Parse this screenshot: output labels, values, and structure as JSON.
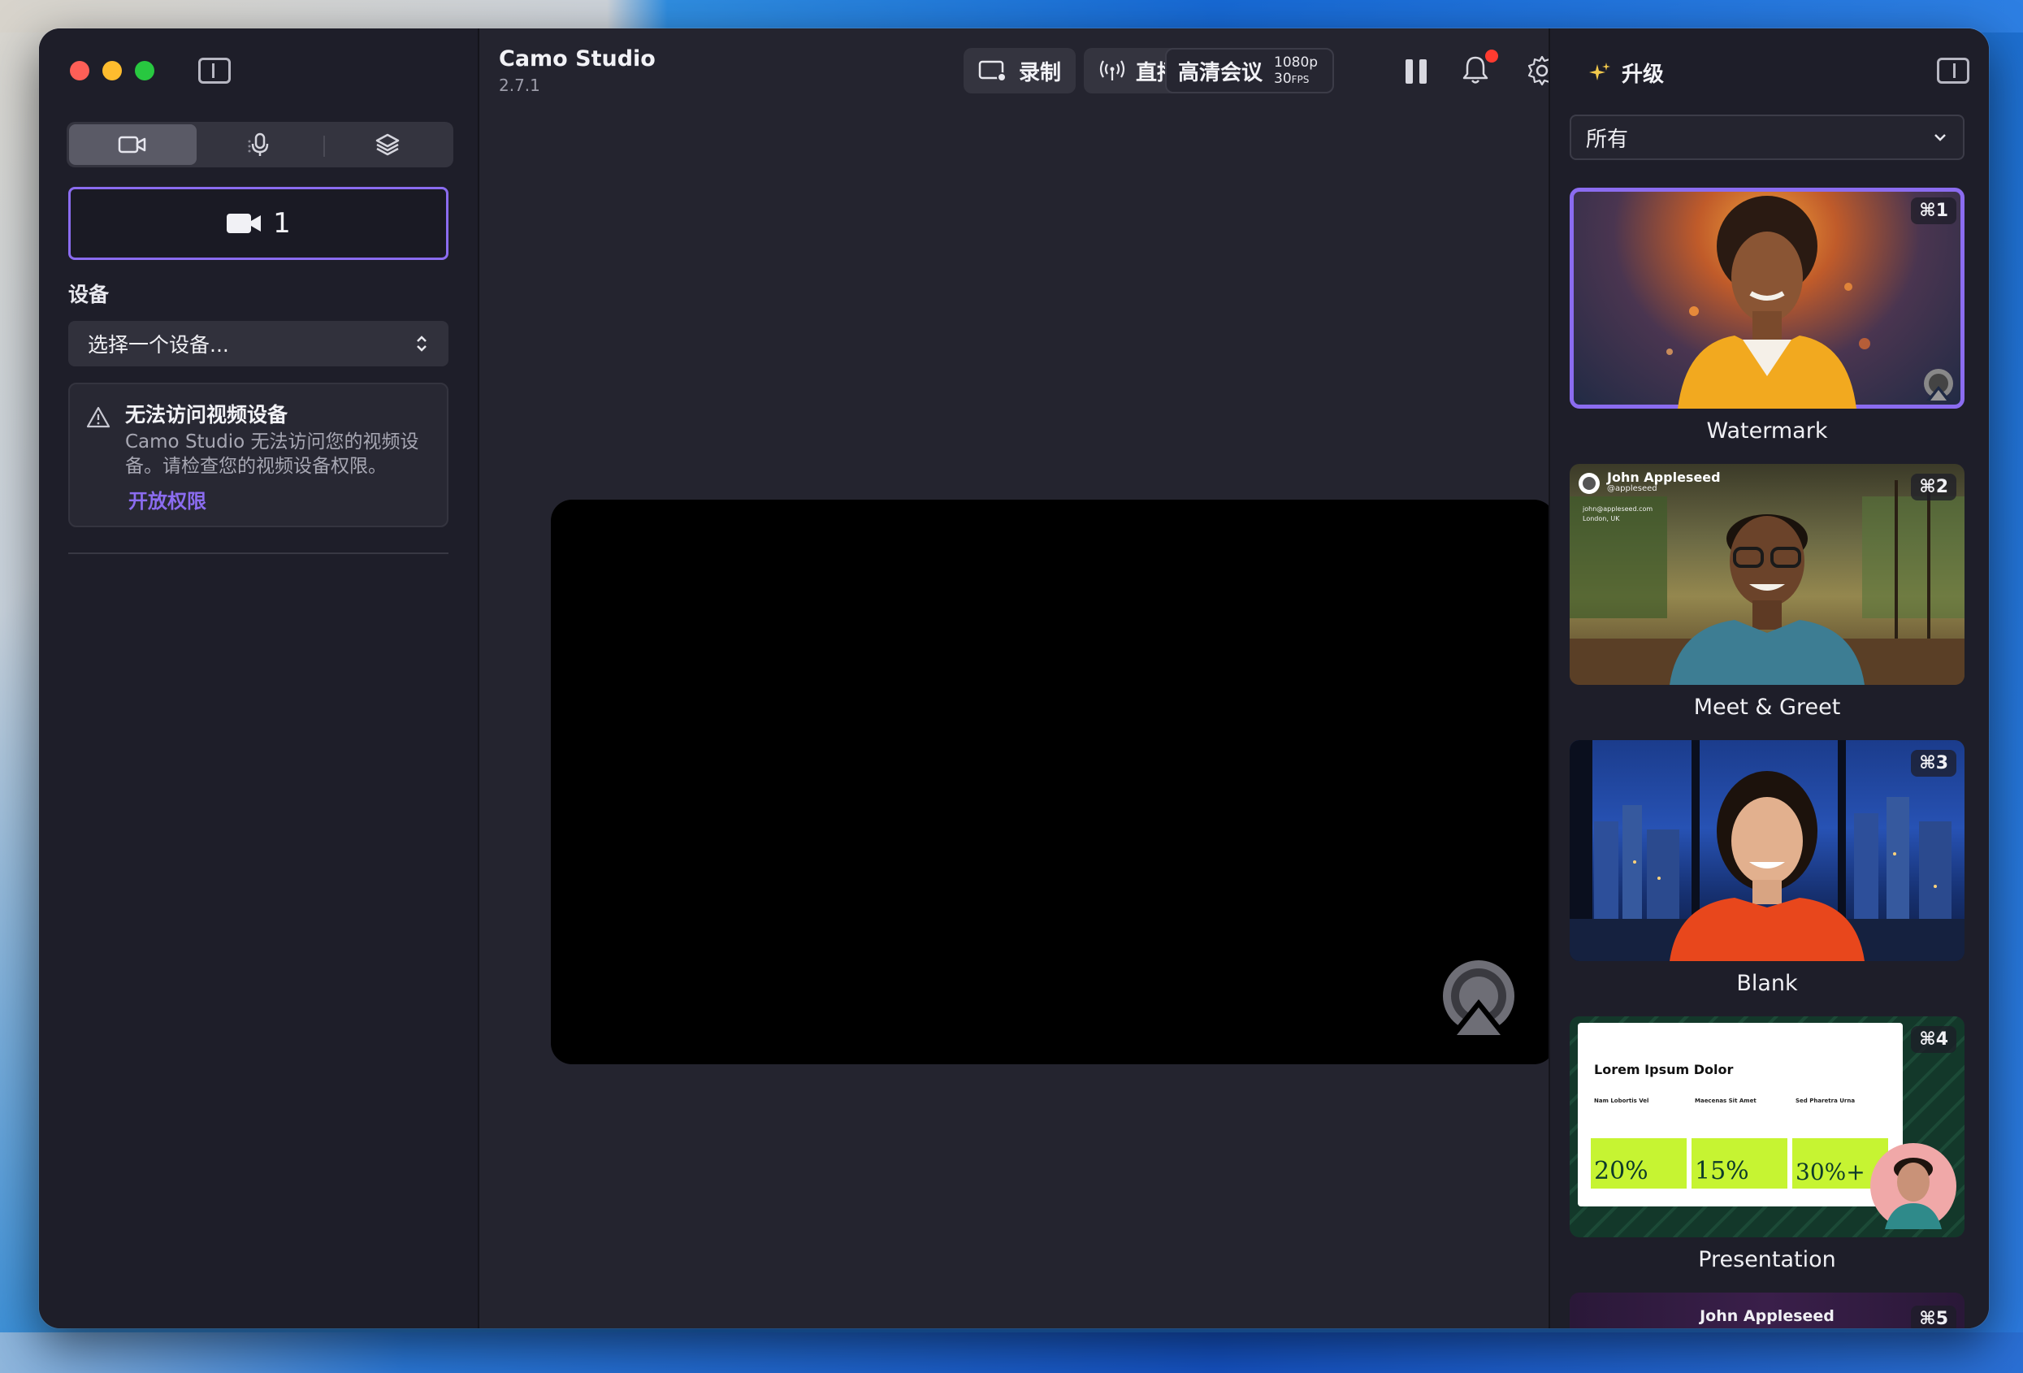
{
  "app": {
    "title": "Camo Studio",
    "version": "2.7.1"
  },
  "toolbar": {
    "record_label": "录制",
    "live_label": "直播",
    "quality_label": "高清会议",
    "resolution": "1080p",
    "fps": "30",
    "fps_unit": "FPS"
  },
  "sidebar": {
    "camera_slot": "1",
    "device_section_label": "设备",
    "device_placeholder": "选择一个设备...",
    "warning": {
      "title": "无法访问视频设备",
      "message": "Camo Studio 无法访问您的视频设备。请检查您的视频设备权限。",
      "action": "开放权限"
    }
  },
  "right_panel": {
    "upgrade_label": "升级",
    "filter_value": "所有",
    "scenes": [
      {
        "name": "Watermark",
        "shortcut": "⌘1",
        "selected": true
      },
      {
        "name": "Meet & Greet",
        "shortcut": "⌘2",
        "overlay_name": "John Appleseed",
        "overlay_handle": "@appleseed",
        "overlay_email": "john@appleseed.com",
        "overlay_location": "London, UK"
      },
      {
        "name": "Blank",
        "shortcut": "⌘3"
      },
      {
        "name": "Presentation",
        "shortcut": "⌘4",
        "slide_title": "Lorem Ipsum Dolor",
        "slide_cols": [
          "Nam Lobortis Vel",
          "Maecenas Sit Amet",
          "Sed Pharetra Urna"
        ],
        "slide_stats": [
          "20%",
          "15%",
          "30%+"
        ]
      },
      {
        "name": "",
        "shortcut": "⌘5",
        "overlay_name": "John Appleseed"
      }
    ]
  },
  "colors": {
    "accent": "#8b6cf0",
    "notification": "#ff3b30",
    "stat_green": "#c6f432"
  }
}
